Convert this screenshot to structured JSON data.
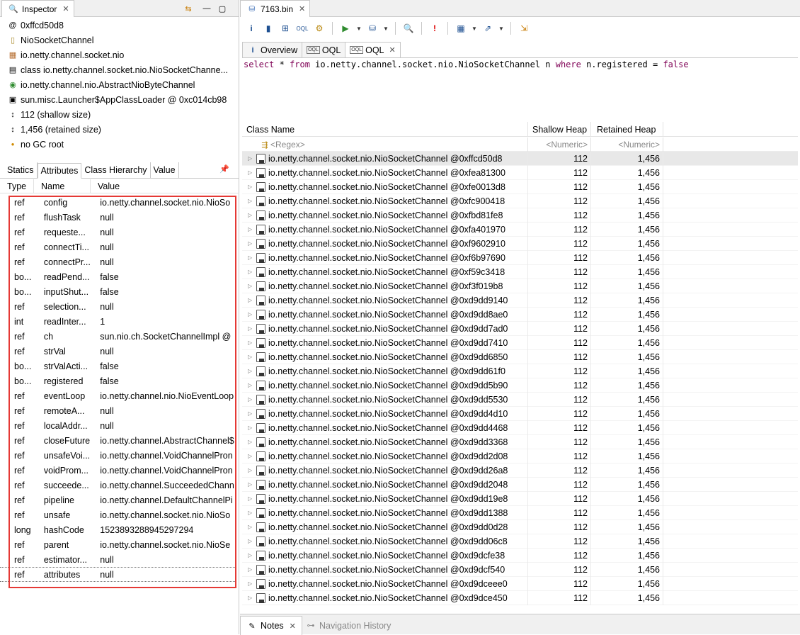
{
  "inspector": {
    "tab_title": "Inspector",
    "info": [
      {
        "icon": "at-icon",
        "text": "0xffcd50d8"
      },
      {
        "icon": "class-file-icon",
        "text": "NioSocketChannel"
      },
      {
        "icon": "package-icon",
        "text": "io.netty.channel.socket.nio"
      },
      {
        "icon": "class-icon",
        "text": "class io.netty.channel.socket.nio.NioSocketChanne..."
      },
      {
        "icon": "superclass-icon",
        "text": "io.netty.channel.nio.AbstractNioByteChannel"
      },
      {
        "icon": "classloader-icon",
        "text": "sun.misc.Launcher$AppClassLoader @ 0xc014cb98"
      },
      {
        "icon": "size-icon",
        "text": "112 (shallow size)"
      },
      {
        "icon": "size-icon",
        "text": "1,456 (retained size)"
      },
      {
        "icon": "gc-root-icon",
        "text": "no GC root"
      }
    ],
    "sub_tabs": [
      "Statics",
      "Attributes",
      "Class Hierarchy",
      "Value"
    ],
    "columns": {
      "type": "Type",
      "name": "Name",
      "value": "Value"
    },
    "attributes": [
      {
        "type": "ref",
        "name": "config",
        "value": "io.netty.channel.socket.nio.NioSo"
      },
      {
        "type": "ref",
        "name": "flushTask",
        "value": "null"
      },
      {
        "type": "ref",
        "name": "requeste...",
        "value": "null"
      },
      {
        "type": "ref",
        "name": "connectTi...",
        "value": "null"
      },
      {
        "type": "ref",
        "name": "connectPr...",
        "value": "null"
      },
      {
        "type": "bo...",
        "name": "readPend...",
        "value": "false"
      },
      {
        "type": "bo...",
        "name": "inputShut...",
        "value": "false"
      },
      {
        "type": "ref",
        "name": "selection...",
        "value": "null"
      },
      {
        "type": "int",
        "name": "readInter...",
        "value": "1"
      },
      {
        "type": "ref",
        "name": "ch",
        "value": "sun.nio.ch.SocketChannelImpl @"
      },
      {
        "type": "ref",
        "name": "strVal",
        "value": "null"
      },
      {
        "type": "bo...",
        "name": "strValActi...",
        "value": "false"
      },
      {
        "type": "bo...",
        "name": "registered",
        "value": "false"
      },
      {
        "type": "ref",
        "name": "eventLoop",
        "value": "io.netty.channel.nio.NioEventLoop"
      },
      {
        "type": "ref",
        "name": "remoteA...",
        "value": "null"
      },
      {
        "type": "ref",
        "name": "localAddr...",
        "value": "null"
      },
      {
        "type": "ref",
        "name": "closeFuture",
        "value": "io.netty.channel.AbstractChannel$"
      },
      {
        "type": "ref",
        "name": "unsafeVoi...",
        "value": "io.netty.channel.VoidChannelPron"
      },
      {
        "type": "ref",
        "name": "voidProm...",
        "value": "io.netty.channel.VoidChannelPron"
      },
      {
        "type": "ref",
        "name": "succeede...",
        "value": "io.netty.channel.SucceededChann"
      },
      {
        "type": "ref",
        "name": "pipeline",
        "value": "io.netty.channel.DefaultChannelPi"
      },
      {
        "type": "ref",
        "name": "unsafe",
        "value": "io.netty.channel.socket.nio.NioSo"
      },
      {
        "type": "long",
        "name": "hashCode",
        "value": "1523893288945297294"
      },
      {
        "type": "ref",
        "name": "parent",
        "value": "io.netty.channel.socket.nio.NioSe"
      },
      {
        "type": "ref",
        "name": "estimator...",
        "value": "null"
      },
      {
        "type": "ref",
        "name": "attributes",
        "value": "null"
      }
    ]
  },
  "editor": {
    "file_tab": "7163.bin",
    "inner_tabs": [
      {
        "label": "Overview",
        "icon": "info-icon"
      },
      {
        "label": "OQL",
        "icon": "oql-icon"
      },
      {
        "label": "OQL",
        "icon": "oql-icon"
      }
    ],
    "query": {
      "select": "select",
      "star": " * ",
      "from": "from",
      "class": " io.netty.channel.socket.nio.NioSocketChannel n ",
      "where": "where",
      "cond": " n.registered = ",
      "value": "false"
    },
    "columns": {
      "name": "Class Name",
      "shallow": "Shallow Heap",
      "retained": "Retained Heap"
    },
    "filters": {
      "name": "<Regex>",
      "shallow": "<Numeric>",
      "retained": "<Numeric>"
    },
    "row_class": "io.netty.channel.socket.nio.NioSocketChannel @ ",
    "rows": [
      {
        "addr": "0xffcd50d8",
        "shallow": "112",
        "retained": "1,456"
      },
      {
        "addr": "0xfea81300",
        "shallow": "112",
        "retained": "1,456"
      },
      {
        "addr": "0xfe0013d8",
        "shallow": "112",
        "retained": "1,456"
      },
      {
        "addr": "0xfc900418",
        "shallow": "112",
        "retained": "1,456"
      },
      {
        "addr": "0xfbd81fe8",
        "shallow": "112",
        "retained": "1,456"
      },
      {
        "addr": "0xfa401970",
        "shallow": "112",
        "retained": "1,456"
      },
      {
        "addr": "0xf9602910",
        "shallow": "112",
        "retained": "1,456"
      },
      {
        "addr": "0xf6b97690",
        "shallow": "112",
        "retained": "1,456"
      },
      {
        "addr": "0xf59c3418",
        "shallow": "112",
        "retained": "1,456"
      },
      {
        "addr": "0xf3f019b8",
        "shallow": "112",
        "retained": "1,456"
      },
      {
        "addr": "0xd9dd9140",
        "shallow": "112",
        "retained": "1,456"
      },
      {
        "addr": "0xd9dd8ae0",
        "shallow": "112",
        "retained": "1,456"
      },
      {
        "addr": "0xd9dd7ad0",
        "shallow": "112",
        "retained": "1,456"
      },
      {
        "addr": "0xd9dd7410",
        "shallow": "112",
        "retained": "1,456"
      },
      {
        "addr": "0xd9dd6850",
        "shallow": "112",
        "retained": "1,456"
      },
      {
        "addr": "0xd9dd61f0",
        "shallow": "112",
        "retained": "1,456"
      },
      {
        "addr": "0xd9dd5b90",
        "shallow": "112",
        "retained": "1,456"
      },
      {
        "addr": "0xd9dd5530",
        "shallow": "112",
        "retained": "1,456"
      },
      {
        "addr": "0xd9dd4d10",
        "shallow": "112",
        "retained": "1,456"
      },
      {
        "addr": "0xd9dd4468",
        "shallow": "112",
        "retained": "1,456"
      },
      {
        "addr": "0xd9dd3368",
        "shallow": "112",
        "retained": "1,456"
      },
      {
        "addr": "0xd9dd2d08",
        "shallow": "112",
        "retained": "1,456"
      },
      {
        "addr": "0xd9dd26a8",
        "shallow": "112",
        "retained": "1,456"
      },
      {
        "addr": "0xd9dd2048",
        "shallow": "112",
        "retained": "1,456"
      },
      {
        "addr": "0xd9dd19e8",
        "shallow": "112",
        "retained": "1,456"
      },
      {
        "addr": "0xd9dd1388",
        "shallow": "112",
        "retained": "1,456"
      },
      {
        "addr": "0xd9dd0d28",
        "shallow": "112",
        "retained": "1,456"
      },
      {
        "addr": "0xd9dd06c8",
        "shallow": "112",
        "retained": "1,456"
      },
      {
        "addr": "0xd9dcfe38",
        "shallow": "112",
        "retained": "1,456"
      },
      {
        "addr": "0xd9dcf540",
        "shallow": "112",
        "retained": "1,456"
      },
      {
        "addr": "0xd9dceee0",
        "shallow": "112",
        "retained": "1,456"
      },
      {
        "addr": "0xd9dce450",
        "shallow": "112",
        "retained": "1,456"
      }
    ]
  },
  "bottom_tabs": {
    "notes": "Notes",
    "navigation": "Navigation History"
  },
  "colors": {
    "highlight_box": "#e53935",
    "keyword": "#7f0055",
    "selected_row": "#e8e8e8"
  }
}
